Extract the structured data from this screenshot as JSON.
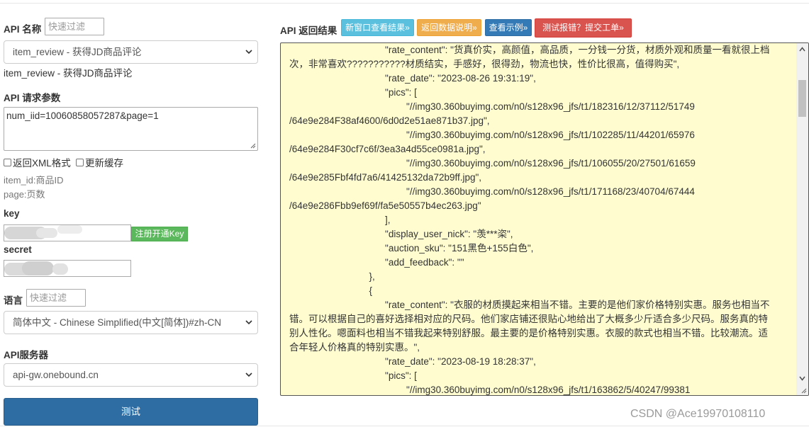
{
  "left_panel": {
    "api_name_label": "API 名称",
    "api_filter_placeholder": "快速过滤",
    "api_select_value": "item_review - 获得JD商品评论",
    "api_description": "item_review - 获得JD商品评论",
    "params_label": "API 请求参数",
    "params_value": "num_iid=10060858057287&page=1",
    "xml_checkbox_label": "返回XML格式",
    "cache_checkbox_label": "更新缓存",
    "param_help": [
      "item_id:商品ID",
      "page:页数"
    ],
    "key_label": "key",
    "register_button": "注册开通Key",
    "secret_label": "secret",
    "lang_label": "语言",
    "lang_filter_placeholder": "快速过滤",
    "lang_select_value": "简体中文 - Chinese Simplified(中文[简体])#zh-CN",
    "server_label": "API服务器",
    "server_select_value": "api-gw.onebound.cn",
    "test_button": "测试"
  },
  "right_panel": {
    "result_label": "API 返回结果",
    "buttons": [
      {
        "label": "新窗口查看结果»",
        "color": "#5bc0de"
      },
      {
        "label": "返回数据说明»",
        "color": "#f0ad4e"
      },
      {
        "label": "查看示例»",
        "color": "#337ab7"
      },
      {
        "label": "测试报错？提交工单»",
        "color": "#d9534f"
      }
    ],
    "result_lines": [
      "                                    \"rate_content\": \"货真价实，高颜值，高品质，一分钱一分货，材质外观和质量一看就很上档",
      "次，非常喜欢???????????材质结实，手感好，很得劲，物流也快，性价比很高，值得购买\",",
      "                                    \"rate_date\": \"2023-08-26 19:31:19\",",
      "                                    \"pics\": [",
      "                                            \"//img30.360buyimg.com/n0/s128x96_jfs/t1/182316/12/37112/51749",
      "/64e9e284F38af4600/6d0d2e51ae871b37.jpg\",",
      "                                            \"//img30.360buyimg.com/n0/s128x96_jfs/t1/102285/11/44201/65976",
      "/64e9e284F30cf7c6f/3ea3a4d55ce0981a.jpg\",",
      "                                            \"//img30.360buyimg.com/n0/s128x96_jfs/t1/106055/20/27501/61659",
      "/64e9e285Fbf4fd7a6/41425132da72b9ff.jpg\",",
      "                                            \"//img30.360buyimg.com/n0/s128x96_jfs/t1/171168/23/40704/67444",
      "/64e9e286Fbb9ef69f/fa5e50557b4ec263.jpg\"",
      "                                    ],",
      "                                    \"display_user_nick\": \"羡***栥\",",
      "                                    \"auction_sku\": \"151黑色+155白色\",",
      "                                    \"add_feedback\": \"\"",
      "                              },",
      "                              {",
      "                                    \"rate_content\": \"衣服的材质摸起来相当不错。主要的是他们家价格特别实惠。服务也相当不",
      "错。可以根据自己的喜好选择相对应的尺码。他们家店铺还很贴心地给出了大概多少斤适合多少尺码。服务真的特",
      "别人性化。嗯面料也相当不错我起来特别舒服。最主要的是价格特别实惠。衣服的款式也相当不错。比较潮流。适",
      "合年轻人价格真的特别实惠。\",",
      "                                    \"rate_date\": \"2023-08-19 18:28:37\",",
      "                                    \"pics\": [",
      "                                            \"//img30.360buyimg.com/n0/s128x96_jfs/t1/163862/5/40247/99381"
    ]
  },
  "watermark": "CSDN @Ace19970108110",
  "icons": {
    "select_arrow": "chevron-down-icon",
    "resize": "resize-grip-icon",
    "scroll_up": "scroll-up-icon",
    "scroll_down": "scroll-down-icon"
  }
}
